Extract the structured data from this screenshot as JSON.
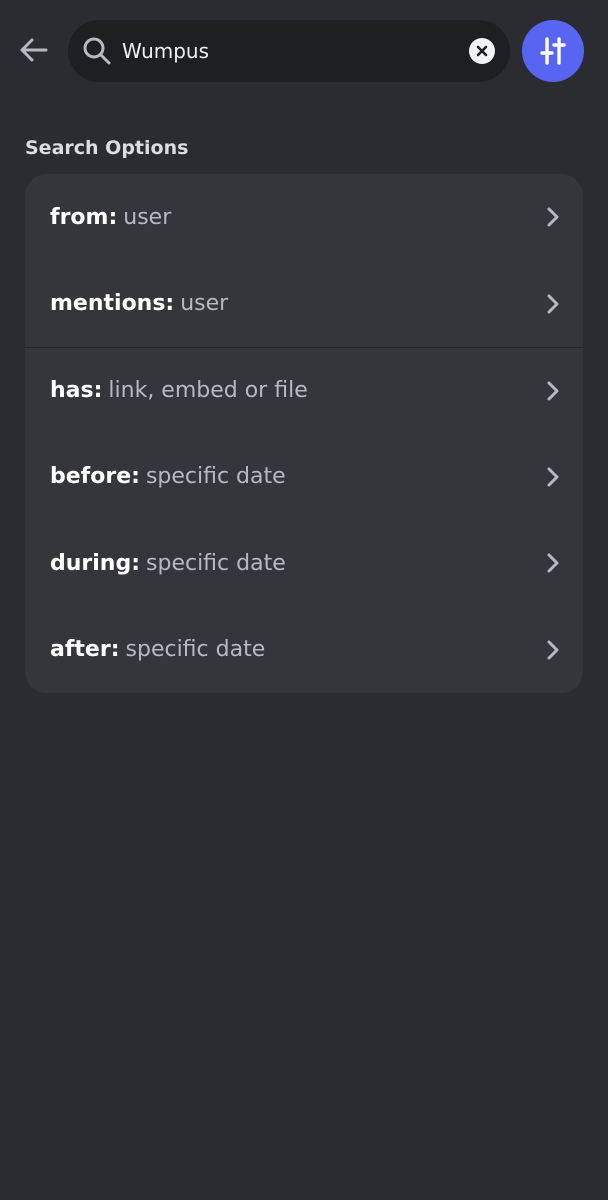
{
  "search": {
    "value": "Wumpus",
    "placeholder": "Search"
  },
  "icons": {
    "back": "arrow-left-icon",
    "search": "magnifier-icon",
    "clear": "close-circle-icon",
    "filter": "sliders-icon",
    "chevron": "chevron-right-icon"
  },
  "colors": {
    "background": "#2b2c31",
    "search_box": "#1e1f23",
    "card": "#35363c",
    "accent": "#5865f2",
    "label_muted": "#b5bac1"
  },
  "section": {
    "title": "Search Options"
  },
  "options": [
    {
      "key": "from:",
      "value": "user"
    },
    {
      "key": "mentions:",
      "value": "user"
    },
    {
      "key": "has:",
      "value": "link, embed or file"
    },
    {
      "key": "before:",
      "value": "specific date"
    },
    {
      "key": "during:",
      "value": "specific date"
    },
    {
      "key": "after:",
      "value": "specific date"
    }
  ]
}
